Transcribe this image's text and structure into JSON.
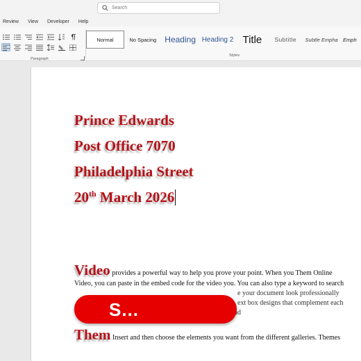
{
  "search": {
    "placeholder": "Search"
  },
  "menu": [
    "Review",
    "View",
    "Developer",
    "Help"
  ],
  "ribbon": {
    "paragraph_label": "Paragraph",
    "styles_label": "Styles",
    "styles": [
      "Normal",
      "No Spacing",
      "Heading",
      "Heading 2",
      "Title",
      "Subtitle",
      "Subtle Empha",
      "Emph"
    ]
  },
  "document": {
    "address": [
      "Prince Edwards",
      "Post Office 7070",
      "Philadelphia Street"
    ],
    "date": {
      "day": "20",
      "suffix": "th",
      "rest": " March 2026"
    },
    "para1": {
      "lead": "Video",
      "line1": " provides a powerful way to help you prove your point. When you Them Online",
      "line2": "Video, you can paste in the embed code for the video you. You can also type a keyword to search",
      "line3": "e your document look professionally",
      "line4": "ext box designs that complement each",
      "line5": "nd"
    },
    "para2": {
      "lead": "Them",
      "line1": " Insert and then choose the elements you want from the different galleries. Themes"
    }
  },
  "overlay": {
    "text": "S..."
  },
  "colors": {
    "heading_red": "#b51319",
    "overlay_red": "#e60000",
    "heading_blue": "#2f5496"
  }
}
